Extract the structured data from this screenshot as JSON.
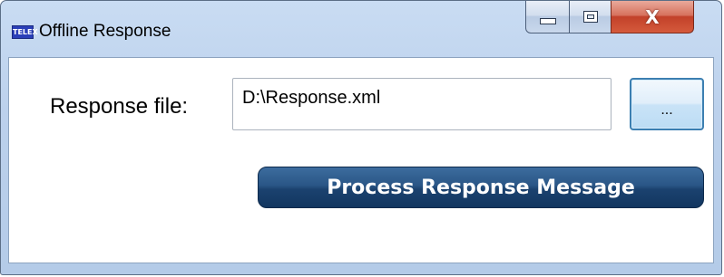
{
  "window": {
    "title": "Offline Response",
    "icon": "telex-app-icon",
    "icon_text": "TELEX",
    "caption_buttons": {
      "minimize": "minimize-icon",
      "maximize": "maximize-icon",
      "close": "X"
    }
  },
  "form": {
    "response_file_label": "Response file:",
    "response_file_value": "D:\\Response.xml",
    "browse_label": "...",
    "process_label": "Process Response Message"
  },
  "colors": {
    "process_button": "#1f4a7a",
    "browse_button_border": "#3c7fb1",
    "close_button": "#c2412a",
    "frame": "#bcd1ec"
  }
}
